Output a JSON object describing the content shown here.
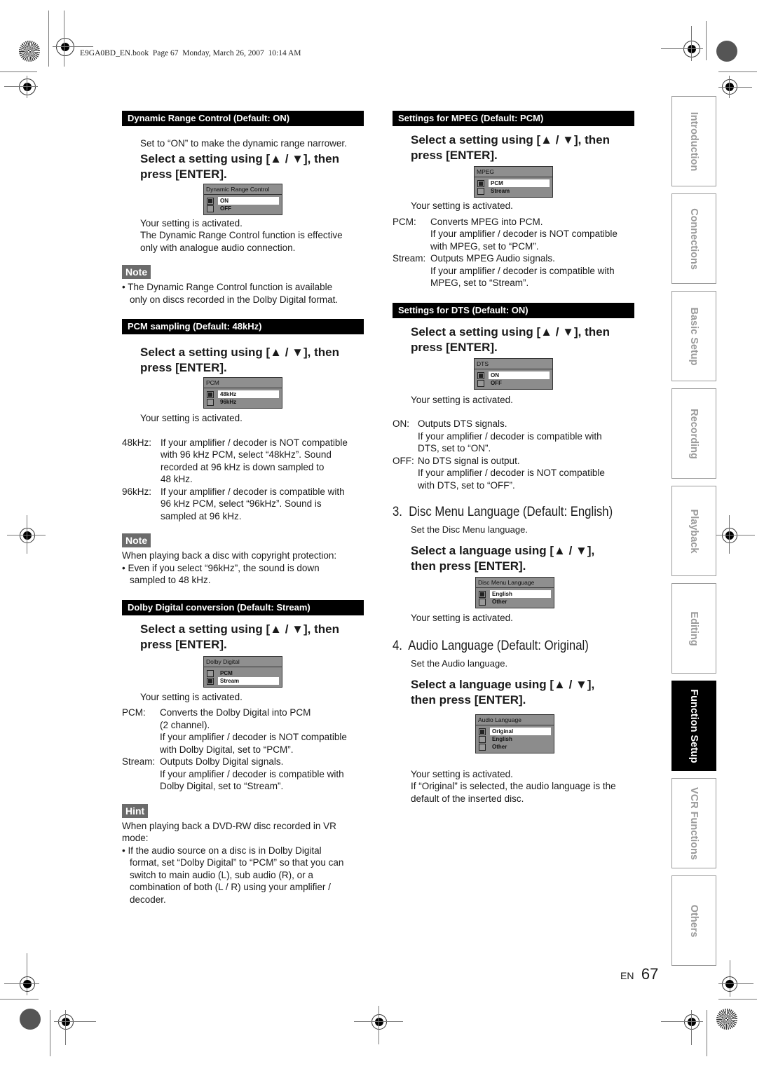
{
  "print_header": "E9GA0BD_EN.book  Page 67  Monday, March 26, 2007  10:14 AM",
  "common": {
    "select_setting": "Select a setting using [▲ / ▼], then press [ENTER].",
    "select_setting_line1": "Select a setting using [▲ / ▼], then",
    "select_setting_line2": "press [ENTER].",
    "select_language_line1": "Select a language using [▲ / ▼],",
    "select_language_line2": "then press [ENTER].",
    "activated": "Your setting is activated."
  },
  "left": {
    "drc": {
      "heading": "Dynamic Range Control (Default: ON)",
      "intro": "Set to “ON” to make the dynamic range narrower.",
      "menu": {
        "title": "Dynamic Range Control",
        "options": [
          {
            "label": "ON",
            "checked": true
          },
          {
            "label": "OFF",
            "checked": false
          }
        ]
      },
      "after1": "The Dynamic Range Control function is effective",
      "after2": "only with analogue audio connection.",
      "note_label": "Note",
      "note_line1": "• The Dynamic Range Control function is available",
      "note_line2": "only on discs recorded in the Dolby Digital format."
    },
    "pcm": {
      "heading": "PCM sampling (Default: 48kHz)",
      "menu": {
        "title": "PCM",
        "options": [
          {
            "label": "48kHz",
            "checked": true
          },
          {
            "label": "96kHz",
            "checked": false
          }
        ]
      },
      "defs": [
        {
          "key": "48kHz:",
          "lines": [
            "If your amplifier / decoder is NOT compatible",
            "with 96 kHz PCM, select “48kHz”. Sound",
            "recorded at 96 kHz is down sampled to",
            "48 kHz."
          ]
        },
        {
          "key": "96kHz:",
          "lines": [
            "If your amplifier / decoder is compatible with",
            "96 kHz PCM, select “96kHz”. Sound is",
            "sampled at 96 kHz."
          ]
        }
      ],
      "note_label": "Note",
      "note_intro": "When playing back a disc with copyright protection:",
      "note_line1": "• Even if you select “96kHz”, the sound is down",
      "note_line2": "sampled to 48 kHz."
    },
    "dolby": {
      "heading": "Dolby Digital conversion (Default: Stream)",
      "menu": {
        "title": "Dolby Digital",
        "options": [
          {
            "label": "PCM",
            "checked": false
          },
          {
            "label": "Stream",
            "checked": true
          }
        ]
      },
      "defs": [
        {
          "key": "PCM:",
          "lines": [
            "Converts the Dolby Digital into PCM",
            "(2 channel).",
            "If your amplifier / decoder is NOT compatible",
            "with Dolby Digital, set to “PCM”."
          ]
        },
        {
          "key": "Stream:",
          "lines": [
            "Outputs Dolby Digital signals.",
            "If your amplifier / decoder is compatible with",
            "Dolby Digital, set to “Stream”."
          ]
        }
      ],
      "hint_label": "Hint",
      "hint_intro1": "When playing back a DVD-RW disc recorded in VR",
      "hint_intro2": "mode:",
      "hint_lines": [
        "• If the audio source on a disc is in Dolby Digital",
        "format, set “Dolby Digital” to “PCM” so that you can",
        "switch to main audio (L), sub audio (R), or a",
        "combination of both (L / R) using your amplifier /",
        "decoder."
      ]
    }
  },
  "right": {
    "mpeg": {
      "heading": "Settings for MPEG (Default: PCM)",
      "menu": {
        "title": "MPEG",
        "options": [
          {
            "label": "PCM",
            "checked": true
          },
          {
            "label": "Stream",
            "checked": false
          }
        ]
      },
      "defs": [
        {
          "key": "PCM:",
          "lines": [
            "Converts MPEG into PCM.",
            "If your amplifier / decoder is NOT compatible",
            "with MPEG, set to “PCM”."
          ]
        },
        {
          "key": "Stream:",
          "lines": [
            "Outputs MPEG Audio signals.",
            "If your amplifier / decoder is compatible with",
            "MPEG, set to “Stream”."
          ]
        }
      ]
    },
    "dts": {
      "heading": "Settings for DTS (Default: ON)",
      "menu": {
        "title": "DTS",
        "options": [
          {
            "label": "ON",
            "checked": true
          },
          {
            "label": "OFF",
            "checked": false
          }
        ]
      },
      "defs": [
        {
          "key": "ON:",
          "lines": [
            "Outputs DTS signals.",
            "If your amplifier / decoder is compatible with",
            "DTS, set to “ON”."
          ]
        },
        {
          "key": "OFF:",
          "lines": [
            "No DTS signal is output.",
            "If your amplifier / decoder is NOT compatible",
            "with DTS, set to “OFF”."
          ]
        }
      ]
    },
    "disc_menu": {
      "heading": "3.  Disc Menu Language (Default: English)",
      "intro": "Set the Disc Menu language.",
      "menu": {
        "title": "Disc Menu Language",
        "options": [
          {
            "label": "English",
            "checked": true
          },
          {
            "label": "Other",
            "checked": false
          }
        ]
      }
    },
    "audio_lang": {
      "heading": "4.  Audio Language (Default: Original)",
      "intro": "Set the Audio language.",
      "menu": {
        "title": "Audio Language",
        "options": [
          {
            "label": "Original",
            "checked": true
          },
          {
            "label": "English",
            "checked": false
          },
          {
            "label": "Other",
            "checked": false
          }
        ]
      },
      "after1": "If “Original” is selected, the audio language is the",
      "after2": "default of the inserted disc."
    }
  },
  "side_tabs": [
    {
      "label": "Introduction",
      "active": false
    },
    {
      "label": "Connections",
      "active": false
    },
    {
      "label": "Basic Setup",
      "active": false
    },
    {
      "label": "Recording",
      "active": false
    },
    {
      "label": "Playback",
      "active": false
    },
    {
      "label": "Editing",
      "active": false
    },
    {
      "label": "Function Setup",
      "active": true
    },
    {
      "label": "VCR Functions",
      "active": false
    },
    {
      "label": "Others",
      "active": false
    }
  ],
  "footer": {
    "lang": "EN",
    "page": "67"
  }
}
